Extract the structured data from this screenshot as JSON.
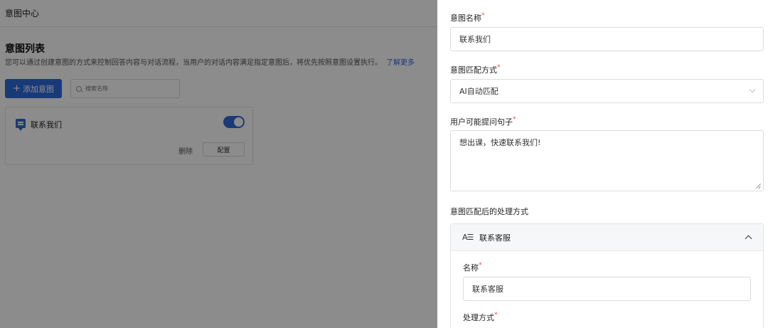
{
  "header": {
    "title": "意图中心"
  },
  "list": {
    "title": "意图列表",
    "description": "您可以通过创建意图的方式来控制回答内容与对话流程，当用户的对话内容满足指定意图后，将优先按照意图设置执行。",
    "learn_more": "了解更多",
    "add_button": "添加意图",
    "search_placeholder": "搜索名称"
  },
  "card": {
    "title": "联系我们",
    "enabled": true,
    "delete_label": "删除",
    "config_label": "配置"
  },
  "drawer": {
    "intent_name": {
      "label": "意图名称",
      "value": "联系我们"
    },
    "match_mode": {
      "label": "意图匹配方式",
      "value": "AI自动匹配"
    },
    "sentences": {
      "label": "用户可能提问句子",
      "value": "想出课，快速联系我们!"
    },
    "after_match": {
      "label": "意图匹配后的处理方式"
    },
    "action": {
      "title": "联系客服",
      "icon_text": "A☰",
      "name": {
        "label": "名称",
        "value": "联系客服"
      },
      "mode": {
        "label": "处理方式"
      }
    },
    "required_mark": "*"
  },
  "colors": {
    "primary": "#2f6bdc",
    "required": "#e5484d"
  }
}
